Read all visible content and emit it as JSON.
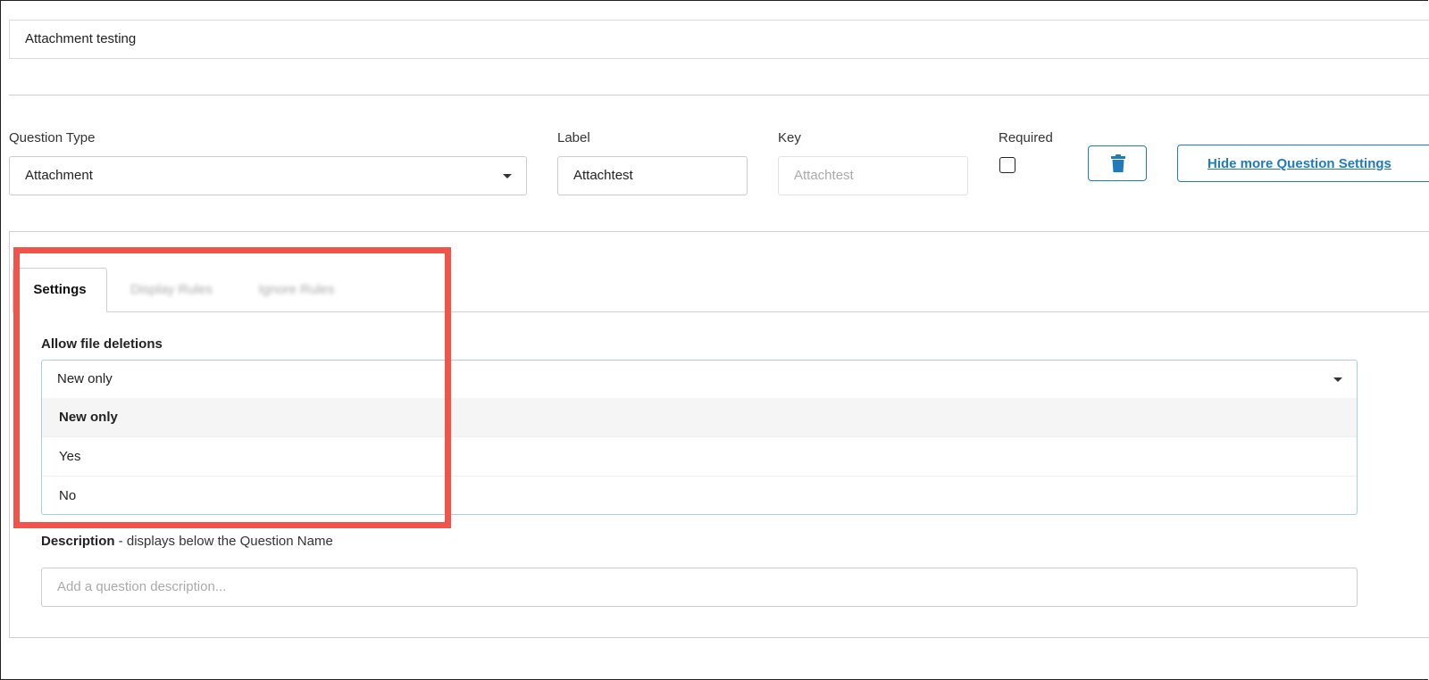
{
  "question_name": "Attachment testing",
  "question_type": {
    "label": "Question Type",
    "value": "Attachment"
  },
  "label_field": {
    "label": "Label",
    "value": "Attachtest"
  },
  "key_field": {
    "label": "Key",
    "placeholder": "Attachtest"
  },
  "required": {
    "label": "Required",
    "checked": false
  },
  "delete_button_icon": "trash-icon",
  "hide_settings_label": "Hide more Question Settings",
  "tabs": [
    {
      "label": "Settings",
      "active": true
    },
    {
      "label": "Display Rules",
      "active": false
    },
    {
      "label": "Ignore Rules",
      "active": false
    }
  ],
  "allow_file_deletions": {
    "label": "Allow file deletions",
    "selected": "New only",
    "options": [
      "New only",
      "Yes",
      "No"
    ]
  },
  "description": {
    "label_bold": "Description",
    "label_rest": " - displays below the Question Name",
    "placeholder": "Add a question description..."
  },
  "colors": {
    "accent": "#1f7bbd",
    "highlight": "#f0544b"
  }
}
